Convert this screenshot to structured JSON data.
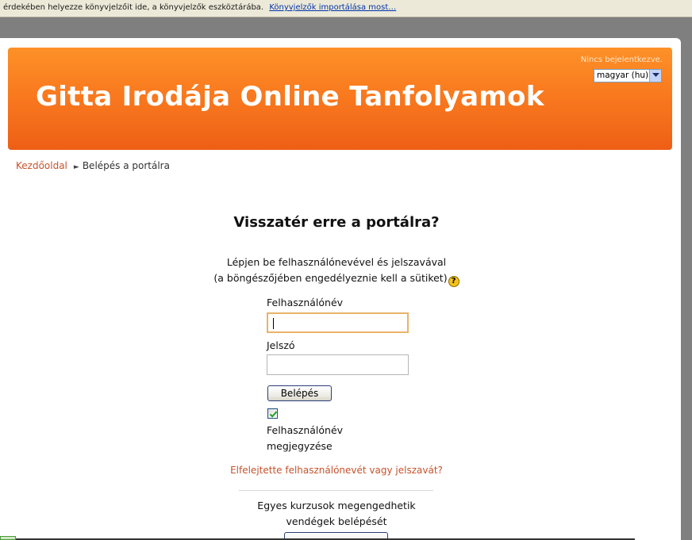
{
  "bookmark_bar": {
    "message": "érdekében helyezze könyvjelzőit ide, a könyvjelzők eszköztárába.",
    "link": "Könyvjelzők importálása most…"
  },
  "header": {
    "title": "Gitta Irodája Online Tanfolyamok",
    "login_status": "Nincs bejelentkezve.",
    "language": "magyar (hu)"
  },
  "breadcrumb": {
    "home": "Kezdőoldal",
    "current": "Belépés a portálra"
  },
  "login": {
    "heading": "Visszatér erre a portálra?",
    "desc_line1": "Lépjen be felhasználónevével és jelszavával",
    "desc_line2": "(a böngészőjében engedélyeznie kell a sütiket)",
    "username_label": "Felhasználónév",
    "username_value": "",
    "password_label": "Jelszó",
    "password_value": "",
    "login_button": "Belépés",
    "remember_line1": "Felhasználónév",
    "remember_line2": "megjegyzése",
    "remember_checked": true,
    "forgot_link": "Elfelejtette felhasználónevét vagy jelszavát?"
  },
  "guest": {
    "line1": "Egyes kurzusok megengedhetik",
    "line2": "vendégek belépését"
  },
  "colors": {
    "header_orange": "#f97a1f",
    "link_orange": "#c6532c"
  }
}
